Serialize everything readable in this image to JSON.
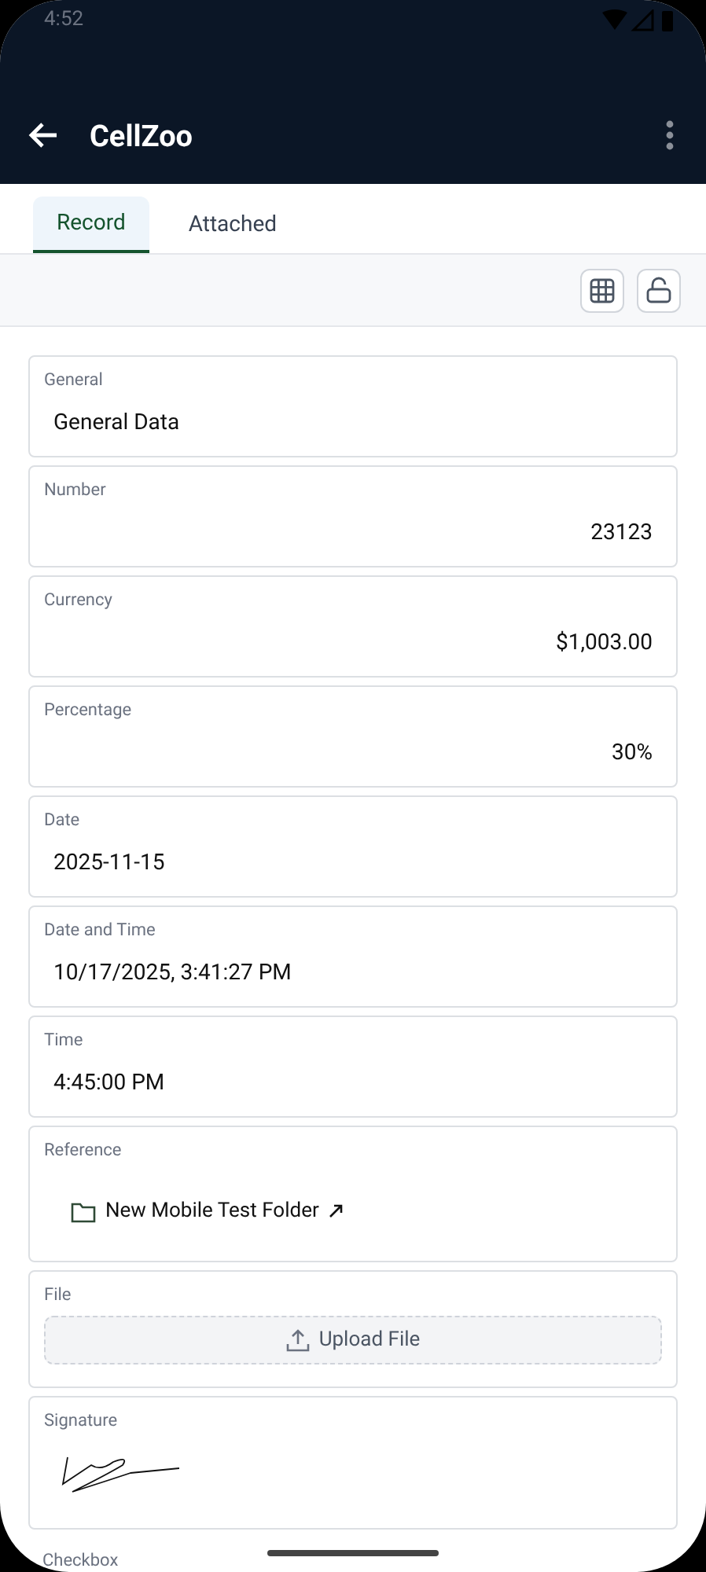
{
  "status_bar": {
    "time": "4:52"
  },
  "app_bar": {
    "title": "CellZoo"
  },
  "tabs": [
    {
      "label": "Record",
      "selected": true
    },
    {
      "label": "Attached",
      "selected": false
    }
  ],
  "fields": [
    {
      "kind": "text",
      "label": "General",
      "value": "General Data"
    },
    {
      "kind": "number",
      "label": "Number",
      "value": "23123"
    },
    {
      "kind": "number",
      "label": "Currency",
      "value": "$1,003.00"
    },
    {
      "kind": "number",
      "label": "Percentage",
      "value": "30%"
    },
    {
      "kind": "text",
      "label": "Date",
      "value": "2025-11-15"
    },
    {
      "kind": "text",
      "label": "Date and Time",
      "value": "10/17/2025, 3:41:27 PM"
    },
    {
      "kind": "text",
      "label": "Time",
      "value": "4:45:00 PM"
    },
    {
      "kind": "reference",
      "label": "Reference",
      "value": "New Mobile Test Folder"
    },
    {
      "kind": "file",
      "label": "File",
      "value": "Upload File"
    },
    {
      "kind": "signature",
      "label": "Signature"
    },
    {
      "kind": "partial",
      "label": "Checkbox"
    }
  ]
}
